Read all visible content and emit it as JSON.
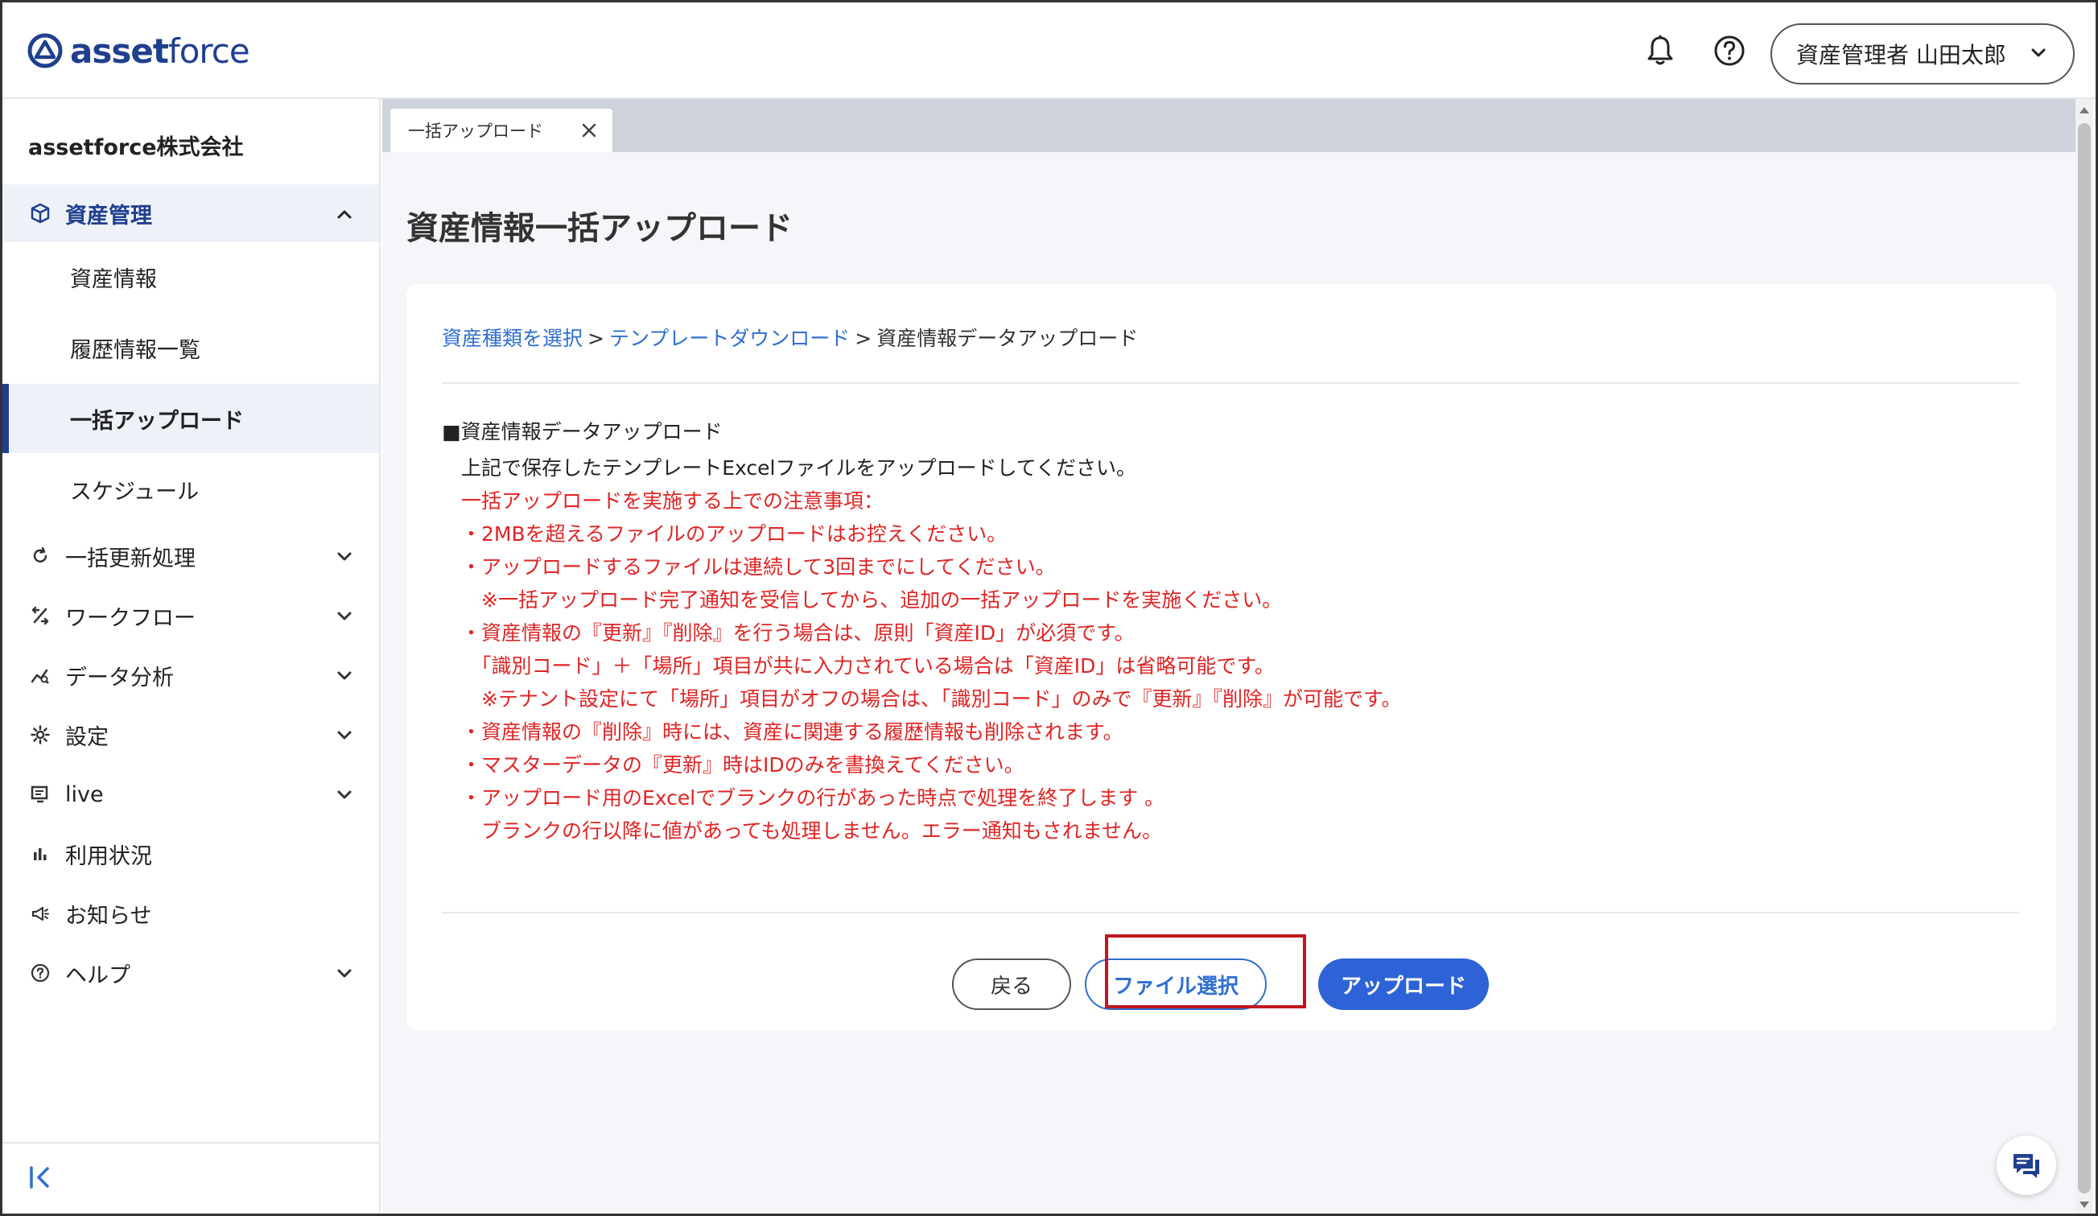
{
  "header": {
    "logo_text_bold": "asset",
    "logo_text_thin": "force",
    "user_label": "資産管理者 山田太郎"
  },
  "sidebar": {
    "company": "assetforce株式会社",
    "section": {
      "label": "資産管理"
    },
    "sub_items": [
      {
        "label": "資産情報"
      },
      {
        "label": "履歴情報一覧"
      },
      {
        "label": "一括アップロード"
      },
      {
        "label": "スケジュール"
      }
    ],
    "items": [
      {
        "label": "一括更新処理",
        "icon": "refresh-icon",
        "expandable": true
      },
      {
        "label": "ワークフロー",
        "icon": "workflow-icon",
        "expandable": true
      },
      {
        "label": "データ分析",
        "icon": "analytics-icon",
        "expandable": true
      },
      {
        "label": "設定",
        "icon": "gear-icon",
        "expandable": true
      },
      {
        "label": "live",
        "icon": "live-icon",
        "expandable": true
      },
      {
        "label": "利用状況",
        "icon": "bar-chart-icon",
        "expandable": false
      },
      {
        "label": "お知らせ",
        "icon": "megaphone-icon",
        "expandable": false
      },
      {
        "label": "ヘルプ",
        "icon": "help-icon",
        "expandable": true
      }
    ]
  },
  "tabs": [
    {
      "label": "一括アップロード"
    }
  ],
  "main": {
    "title": "資産情報一括アップロード",
    "breadcrumb": {
      "step1": "資産種類を選択",
      "step2": "テンプレートダウンロード",
      "step3": "資産情報データアップロード",
      "sep": ">"
    },
    "section_head": "■資産情報データアップロード",
    "instruction": "上記で保存したテンプレートExcelファイルをアップロードしてください。",
    "notes": [
      "一括アップロードを実施する上での注意事項：",
      "・2MBを超えるファイルのアップロードはお控えください。",
      "・アップロードするファイルは連続して3回までにしてください。",
      "　※一括アップロード完了通知を受信してから、追加の一括アップロードを実施ください。",
      "・資産情報の『更新』『削除』を行う場合は、原則「資産ID」が必須です。",
      "　「識別コード」＋「場所」項目が共に入力されている場合は「資産ID」は省略可能です。",
      "　※テナント設定にて「場所」項目がオフの場合は、「識別コード」のみで『更新』『削除』が可能です。",
      "・資産情報の『削除』時には、資産に関連する履歴情報も削除されます。",
      "・マスターデータの『更新』時はIDのみを書換えてください。",
      "・アップロード用のExcelでブランクの行があった時点で処理を終了します 。",
      "　ブランクの行以降に値があっても処理しません。エラー通知もされません。"
    ],
    "buttons": {
      "back": "戻る",
      "file_select": "ファイル選択",
      "upload": "アップロード"
    }
  },
  "colors": {
    "brand": "#1f3f8f",
    "link": "#2f6fd0",
    "primary_button": "#2d63d6",
    "warning_text": "#e02424",
    "highlight_box": "#c0171e"
  }
}
